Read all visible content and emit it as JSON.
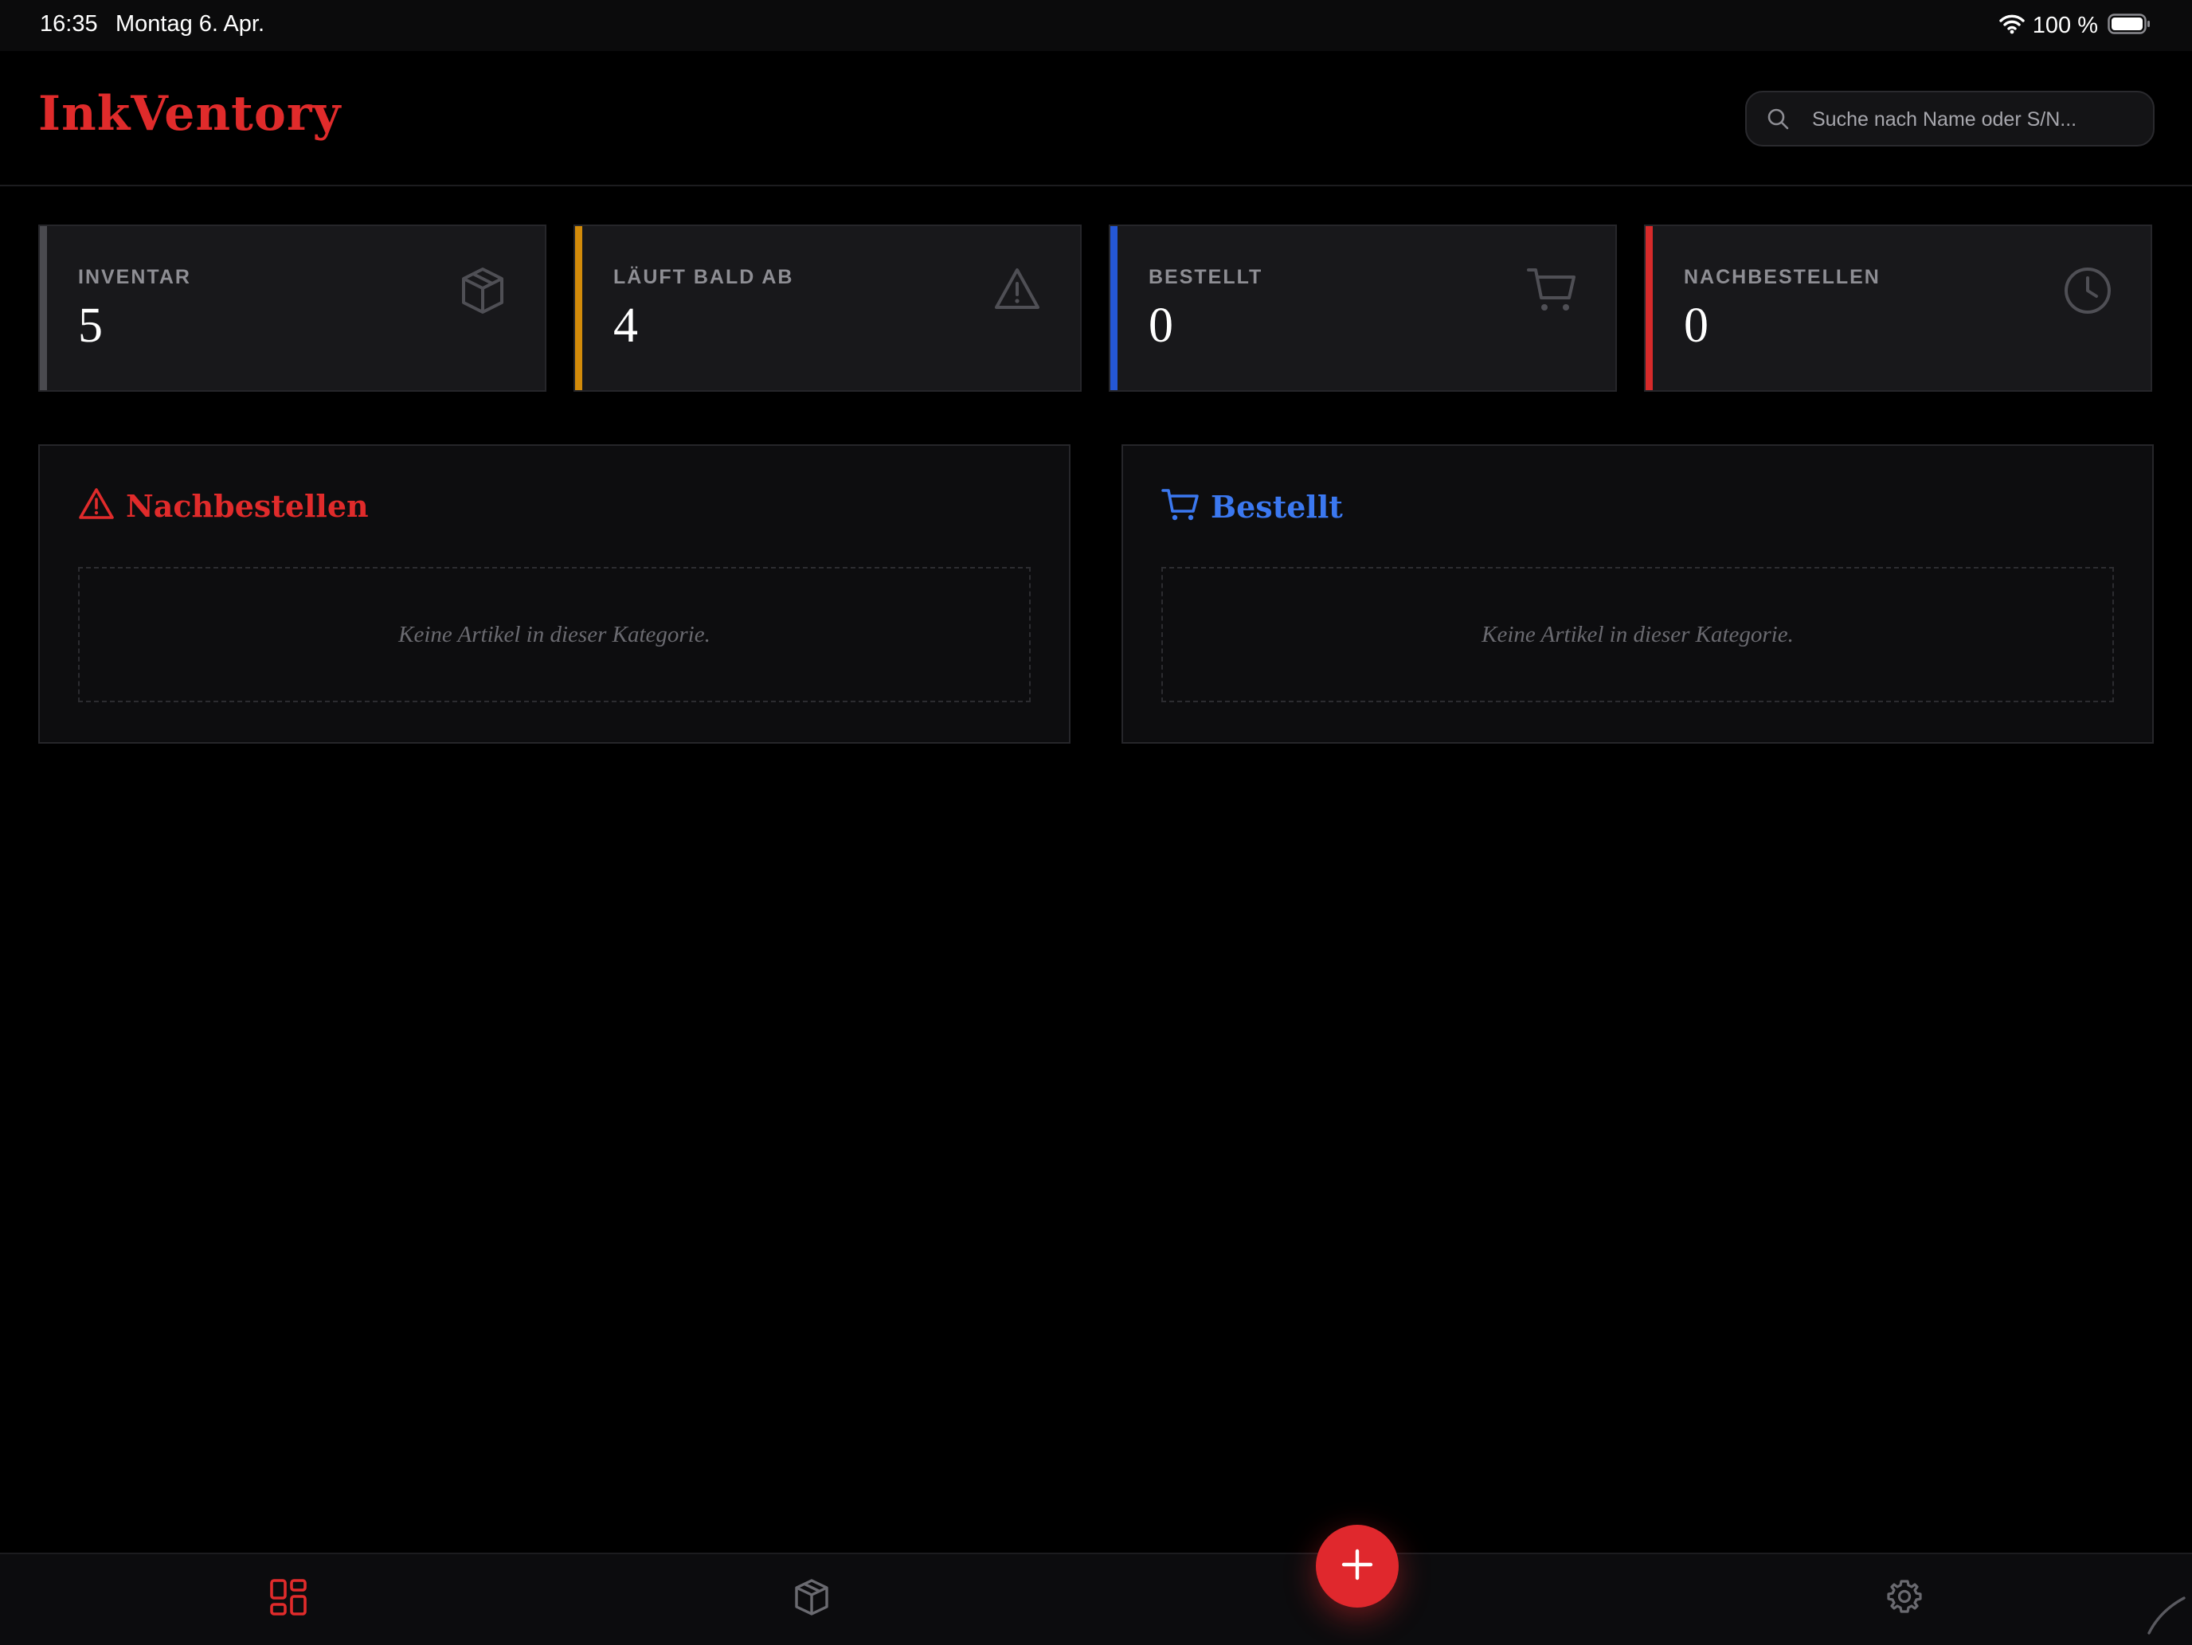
{
  "status_bar": {
    "time": "16:35",
    "date": "Montag 6. Apr.",
    "battery_text": "100 %",
    "icons": [
      "wifi-icon",
      "battery-icon"
    ]
  },
  "header": {
    "logo": "InkVentory",
    "search": {
      "placeholder": "Suche nach Name oder S/N...",
      "value": "",
      "icon": "search-icon"
    }
  },
  "stats": [
    {
      "label": "INVENTAR",
      "value": "5",
      "icon": "box-icon",
      "accent": "#4a4a4f"
    },
    {
      "label": "LÄUFT BALD AB",
      "value": "4",
      "icon": "warning-icon",
      "accent": "#d28b0a"
    },
    {
      "label": "BESTELLT",
      "value": "0",
      "icon": "cart-icon",
      "accent": "#2457d6"
    },
    {
      "label": "NACHBESTELLEN",
      "value": "0",
      "icon": "clock-icon",
      "accent": "#d62a2a"
    }
  ],
  "panels": [
    {
      "title": "Nachbestellen",
      "icon": "warning-icon",
      "color": "#e02b2b",
      "empty_text": "Keine Artikel in dieser Kategorie."
    },
    {
      "title": "Bestellt",
      "icon": "cart-icon",
      "color": "#3b78f0",
      "empty_text": "Keine Artikel in dieser Kategorie."
    }
  ],
  "bottom_nav": {
    "items": [
      "dashboard-icon",
      "box-icon",
      "gear-icon"
    ],
    "active": "dashboard-icon",
    "fab_icon": "plus-icon"
  },
  "colors": {
    "brand": "#e02b2b",
    "background": "#000000",
    "card": "#18181b",
    "ordered_blue": "#3b78f0"
  }
}
